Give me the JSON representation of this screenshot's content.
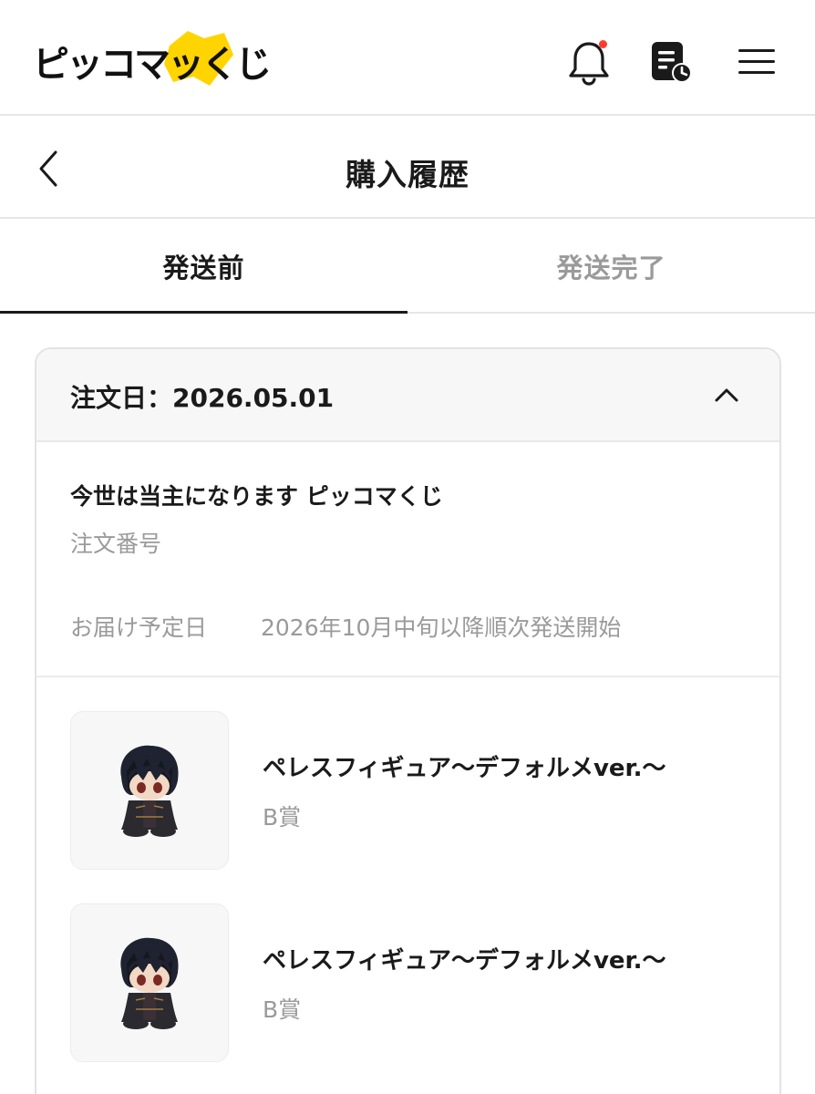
{
  "app": {
    "logo_text": "ピッコマッくじ",
    "brand_yellow": "#ffd400",
    "notification_dot_color": "#ff3b30"
  },
  "icons": {
    "bell": "bell-icon",
    "history": "purchase-history-icon",
    "menu": "hamburger-menu-icon",
    "back": "chevron-left-icon",
    "collapse": "chevron-up-icon"
  },
  "page": {
    "title": "購入履歴"
  },
  "tabs": [
    {
      "label": "発送前",
      "active": true
    },
    {
      "label": "発送完了",
      "active": false
    }
  ],
  "order": {
    "date_label": "注文日：2026.05.01",
    "product_title": "今世は当主になります ピッコマくじ",
    "order_number_label": "注文番号",
    "delivery_label": "お届け予定日",
    "delivery_value": "2026年10月中旬以降順次発送開始",
    "items": [
      {
        "name": "ペレスフィギュア〜デフォルメver.〜",
        "prize": "B賞"
      },
      {
        "name": "ペレスフィギュア〜デフォルメver.〜",
        "prize": "B賞"
      }
    ]
  }
}
